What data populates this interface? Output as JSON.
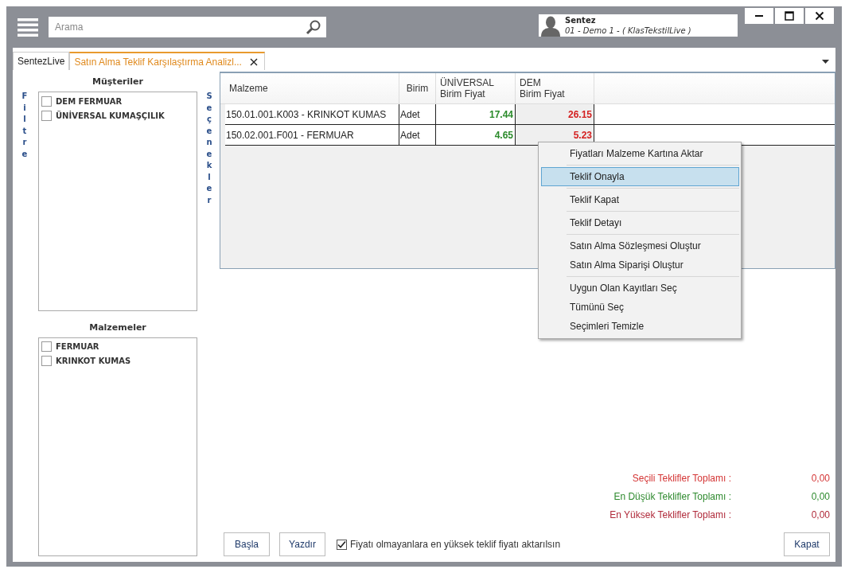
{
  "search": {
    "placeholder": "Arama"
  },
  "user": {
    "name": "Sentez",
    "company": "01 - Demo 1 - ( KlasTekstilLive )"
  },
  "window_buttons": [
    {
      "kind": "minimize"
    },
    {
      "kind": "maximize"
    },
    {
      "kind": "close"
    }
  ],
  "tabs": [
    {
      "label": "SentezLive",
      "selected": false,
      "closable": false
    },
    {
      "label": "Satın Alma Teklif Karşılaştırma Analizl...",
      "selected": true,
      "closable": true
    }
  ],
  "filter": {
    "label": "Filtre",
    "customers": {
      "title": "Müşteriler",
      "items": [
        {
          "label": "DEM FERMUAR",
          "checked": false
        },
        {
          "label": "ÜNİVERSAL KUMAŞÇILIK",
          "checked": false
        }
      ]
    },
    "materials": {
      "title": "Malzemeler",
      "items": [
        {
          "label": "FERMUAR",
          "checked": false
        },
        {
          "label": "KRINKOT KUMAS",
          "checked": false
        }
      ]
    }
  },
  "options_label": "Seçenekler",
  "table": {
    "columns": [
      {
        "lines": [
          "Malzeme"
        ]
      },
      {
        "lines": [
          "Birim"
        ]
      },
      {
        "lines": [
          "ÜNİVERSAL",
          "Birim Fiyat"
        ]
      },
      {
        "lines": [
          "DEM",
          "Birim Fiyat"
        ]
      }
    ],
    "rows": [
      {
        "material": "150.01.001.K003 - KRINKOT KUMAS",
        "unit": "Adet",
        "prices": [
          {
            "value": "17.44",
            "color": "#2a8a2a"
          },
          {
            "value": "26.15",
            "color": "#d42020"
          }
        ]
      },
      {
        "material": "150.02.001.F001 - FERMUAR",
        "unit": "Adet",
        "prices": [
          {
            "value": "4.65",
            "color": "#2a8a2a"
          },
          {
            "value": "5.23",
            "color": "#d42020"
          }
        ]
      }
    ]
  },
  "context_menu": {
    "groups": [
      [
        {
          "label": "Fiyatları Malzeme Kartına Aktar",
          "selected": false
        }
      ],
      [
        {
          "label": "Teklif Onayla",
          "selected": true
        }
      ],
      [
        {
          "label": "Teklif Kapat",
          "selected": false
        }
      ],
      [
        {
          "label": "Teklif Detayı",
          "selected": false
        }
      ],
      [
        {
          "label": "Satın Alma Sözleşmesi Oluştur",
          "selected": false
        },
        {
          "label": "Satın Alma Siparişi Oluştur",
          "selected": false
        }
      ],
      [
        {
          "label": "Uygun Olan Kayıtları Seç",
          "selected": false
        },
        {
          "label": "Tümünü Seç",
          "selected": false
        },
        {
          "label": "Seçimleri Temizle",
          "selected": false
        }
      ]
    ]
  },
  "totals": [
    {
      "label": "Seçili Teklifler Toplamı :",
      "value": "0,00",
      "color": "#d43535"
    },
    {
      "label": "En Düşük Teklifler Toplamı :",
      "value": "0,00",
      "color": "#2e8a2e"
    },
    {
      "label": "En Yüksek Teklifler Toplamı :",
      "value": "0,00",
      "color": "#b02a3a"
    }
  ],
  "buttons": {
    "start": "Başla",
    "print": "Yazdır",
    "close": "Kapat"
  },
  "transfer_option": {
    "label": "Fiyatı olmayanlara en yüksek teklif fiyatı aktarılsın",
    "checked": true
  }
}
